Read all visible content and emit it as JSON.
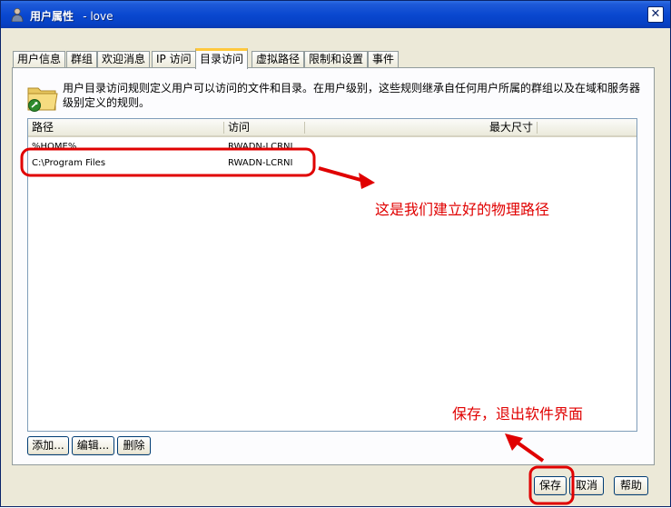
{
  "window": {
    "title": "用户属性",
    "subtitle": "- love",
    "close_glyph": "✕"
  },
  "tabs": [
    {
      "label": "用户信息",
      "active": false
    },
    {
      "label": "群组",
      "active": false
    },
    {
      "label": "欢迎消息",
      "active": false
    },
    {
      "label": "IP 访问",
      "active": false
    },
    {
      "label": "目录访问",
      "active": true
    },
    {
      "label": "虚拟路径",
      "active": false
    },
    {
      "label": "限制和设置",
      "active": false
    },
    {
      "label": "事件",
      "active": false
    }
  ],
  "description": "用户目录访问规则定义用户可以访问的文件和目录。在用户级别，这些规则继承自任何用户所属的群组以及在域和服务器级别定义的规则。",
  "list": {
    "columns": [
      "路径",
      "访问",
      "最大尺寸"
    ],
    "rows": [
      {
        "path": "%HOME%",
        "access": "RWADN-LCRNI",
        "max_size": ""
      },
      {
        "path": "C:\\Program Files",
        "access": "RWADN-LCRNI",
        "max_size": ""
      }
    ]
  },
  "list_buttons": {
    "add": "添加...",
    "edit": "编辑...",
    "delete": "删除"
  },
  "dialog_buttons": {
    "save": "保存",
    "cancel": "取消",
    "help": "帮助"
  },
  "annotations": {
    "physical_path_note": "这是我们建立好的物理路径",
    "save_note": "保存，退出软件界面",
    "color": "#e00000"
  },
  "icons": {
    "title": "user-icon",
    "folder": "folder-key-icon"
  }
}
